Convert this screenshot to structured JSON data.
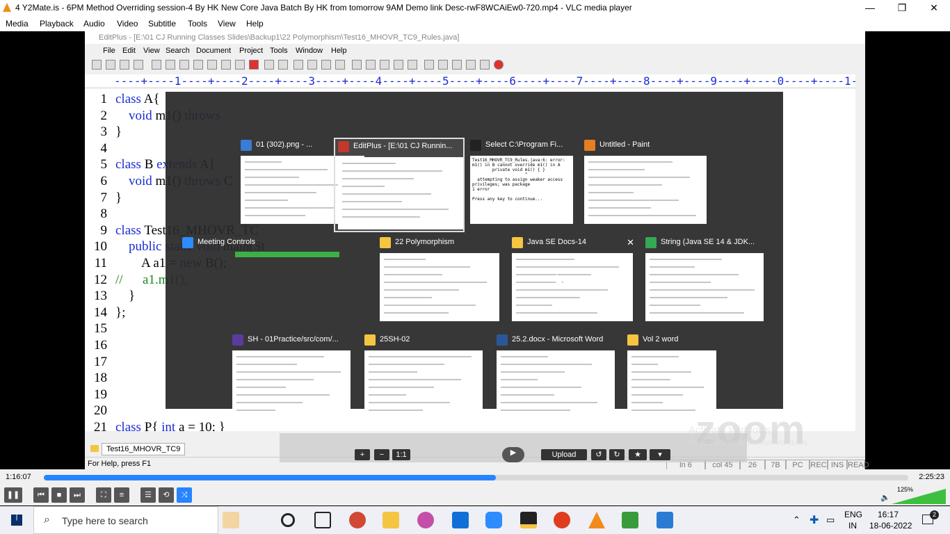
{
  "vlc": {
    "title": "4 Y2Mate.is - 6PM Method Overriding session-4 By HK New Core Java Batch By HK from tomorrow 9AM  Demo link Desc-rwF8WCAiEw0-720.mp4 - VLC media player",
    "menu": [
      "Media",
      "Playback",
      "Audio",
      "Video",
      "Subtitle",
      "Tools",
      "View",
      "Help"
    ],
    "win_buttons": [
      "—",
      "❐",
      "✕"
    ],
    "time_elapsed": "1:16:07",
    "time_total": "2:25:23",
    "progress": 0.523,
    "volume_label": "125%",
    "volume": 1.0
  },
  "editplus": {
    "title": "EditPlus - [E:\\01 CJ Running Classes Slides\\Backup1\\22 Polymorphism\\Test16_MHOVR_TC9_Rules.java]",
    "menu": [
      "File",
      "Edit",
      "View",
      "Search",
      "Document",
      "Project",
      "Tools",
      "Window",
      "Help"
    ],
    "ruler": "----+----1----+----2----+----3----+----4----+----5----+----6----+----7----+----8----+----9----+----0----+----1----+----2-",
    "lines": [
      {
        "n": "1",
        "code": "class A{"
      },
      {
        "n": "2",
        "code": "    void m1() throws"
      },
      {
        "n": "3",
        "code": "}"
      },
      {
        "n": "4",
        "code": ""
      },
      {
        "n": "5",
        "code": "class B extends A{"
      },
      {
        "n": "6",
        "code": "    void m1() throws C"
      },
      {
        "n": "7",
        "code": "}"
      },
      {
        "n": "8",
        "code": ""
      },
      {
        "n": "9",
        "code": "class Test16_MHOVR_TC"
      },
      {
        "n": "10",
        "code": "    public static void main(St"
      },
      {
        "n": "11",
        "code": "        A a1 = new B();"
      },
      {
        "n": "12",
        "code": "//      a1.m1();"
      },
      {
        "n": "13",
        "code": "    }"
      },
      {
        "n": "14",
        "code": "};"
      },
      {
        "n": "15",
        "code": ""
      },
      {
        "n": "16",
        "code": ""
      },
      {
        "n": "17",
        "code": ""
      },
      {
        "n": "18",
        "code": ""
      },
      {
        "n": "19",
        "code": ""
      },
      {
        "n": "20",
        "code": ""
      },
      {
        "n": "21",
        "code": "class P{ int a = 10; }"
      }
    ],
    "tab": "Test16_MHOVR_TC9",
    "status_help": "For Help, press F1",
    "status_boxes": [
      "ln 6",
      "col 45",
      "26",
      "7B",
      "PC",
      "REC",
      "INS",
      "READ"
    ]
  },
  "switcher": {
    "items": [
      {
        "label": "01 (302).png - ...",
        "icon_color": "#3a7bd5",
        "selected": false
      },
      {
        "label": "EditPlus - [E:\\01 CJ Runnin...",
        "icon_color": "#c0392b",
        "selected": true
      },
      {
        "label": "Select C:\\Program Fi...",
        "icon_color": "#222222",
        "selected": false,
        "preview_text": "Test16_MHOVR_TC9_Rules.java:6: error: m1() in B cannot override m1() in A\n        private void m1() { }\n                     ^\n  attempting to assign weaker access privileges; was package\n1 error\n\nPress any key to continue..."
      },
      {
        "label": "Untitled - Paint",
        "icon_color": "#e67e22",
        "selected": false
      },
      {
        "label": "Meeting Controls",
        "icon_color": "#2d8cff",
        "selected": false
      },
      {
        "label": "22 Polymorphism",
        "icon_color": "#f5c542",
        "selected": false
      },
      {
        "label": "Java SE Docs-14",
        "icon_color": "#f5c542",
        "selected": false
      },
      {
        "label": "String (Java SE 14 & JDK...",
        "icon_color": "#34a853",
        "selected": false
      },
      {
        "label": "SH - 01Practice/src/com/...",
        "icon_color": "#5b3b9e",
        "selected": false
      },
      {
        "label": "25SH-02",
        "icon_color": "#f5c542",
        "selected": false
      },
      {
        "label": "25.2.docx - Microsoft Word",
        "icon_color": "#2b579a",
        "selected": false
      },
      {
        "label": "Vol 2   word",
        "icon_color": "#f5c542",
        "selected": false
      }
    ],
    "close_icon": "✕"
  },
  "zoom": {
    "upload": "Upload",
    "ratio": "1:1",
    "watermark": "zoom",
    "activate_title": "Activate Windows",
    "activate_sub": "Go to Settings to activate Windows."
  },
  "taskbar": {
    "search_placeholder": "Type here to search",
    "lang_line1": "ENG",
    "lang_line2": "IN",
    "time": "16:17",
    "date": "18-06-2022",
    "notif_count": "2"
  }
}
